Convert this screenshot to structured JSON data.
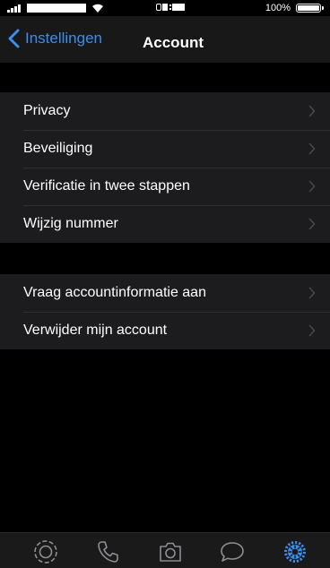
{
  "status_bar": {
    "battery_text": "100%"
  },
  "nav": {
    "back_label": "Instellingen",
    "title": "Account"
  },
  "groups": [
    {
      "items": [
        {
          "label": "Privacy"
        },
        {
          "label": "Beveiliging"
        },
        {
          "label": "Verificatie in twee stappen"
        },
        {
          "label": "Wijzig nummer"
        }
      ]
    },
    {
      "items": [
        {
          "label": "Vraag accountinformatie aan"
        },
        {
          "label": "Verwijder mijn account"
        }
      ]
    }
  ],
  "tab_bar": {
    "tabs": [
      {
        "icon": "status-icon",
        "active": false
      },
      {
        "icon": "phone-icon",
        "active": false
      },
      {
        "icon": "camera-icon",
        "active": false
      },
      {
        "icon": "chat-icon",
        "active": false
      },
      {
        "icon": "settings-gear-icon",
        "active": true
      }
    ]
  },
  "colors": {
    "accent": "#3b8df0",
    "background": "#000000",
    "cell_background": "#1c1c1e",
    "nav_background": "#181818",
    "inactive_icon": "#8e8e93"
  }
}
